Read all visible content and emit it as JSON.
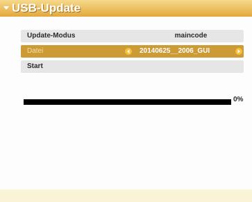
{
  "window": {
    "title": "USB-Update",
    "icon": "menu-bullet-icon"
  },
  "settings": [
    {
      "label": "Update-Modus",
      "value": "maincode"
    },
    {
      "label": "Datei",
      "value": "20140625__2006_GUI"
    },
    {
      "label": "Start"
    }
  ],
  "progress": {
    "fraction": 0.0,
    "text": "0%"
  },
  "colors": {
    "title_bar": "#e2a83c",
    "selected_row": "#cc9b36",
    "row_bg": "#e6e6e6",
    "progress_bar": "#000000",
    "footer": "#fbf3d6"
  }
}
